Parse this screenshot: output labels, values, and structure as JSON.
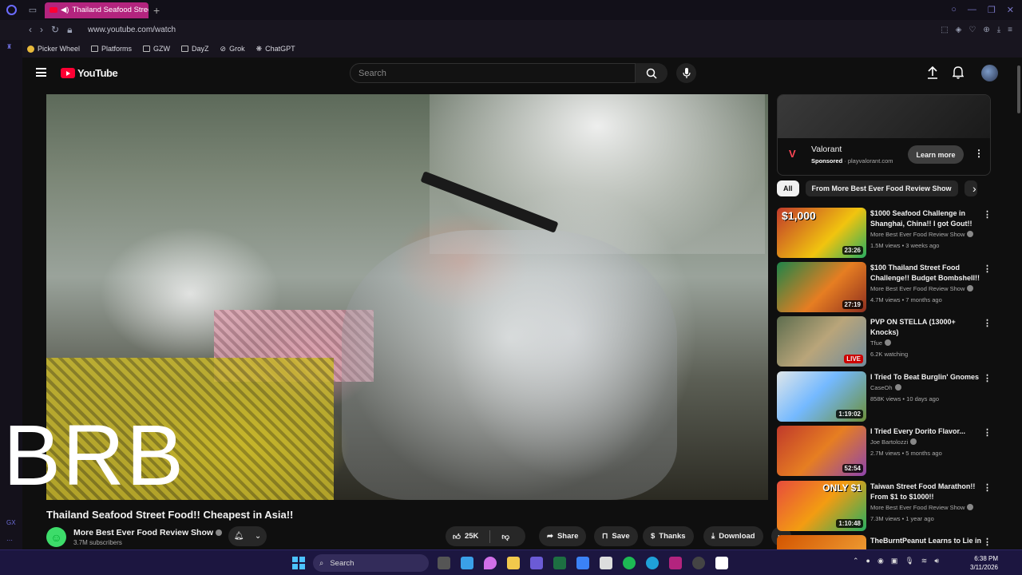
{
  "browser": {
    "tab_title": "Thailand Seafood Street",
    "url": "www.youtube.com/watch",
    "bookmarks": [
      "Picker Wheel",
      "Platforms",
      "GZW",
      "DayZ",
      "Grok",
      "ChatGPT"
    ],
    "side_rail_label": "GX"
  },
  "youtube": {
    "logo_text": "YouTube",
    "search_placeholder": "Search"
  },
  "video": {
    "overlay_text": "BRB",
    "title": "Thailand Seafood Street Food!! Cheapest in Asia!!",
    "channel": "More Best Ever Food Review Show",
    "subscribers": "3.7M subscribers",
    "likes": "25K",
    "share_label": "Share",
    "save_label": "Save",
    "thanks_label": "Thanks",
    "download_label": "Download"
  },
  "ad": {
    "title": "Valorant",
    "sponsored": "Sponsored",
    "domain": "playvalorant.com",
    "cta": "Learn more"
  },
  "chips": [
    "All",
    "From More Best Ever Food Review Show"
  ],
  "recommendations": [
    {
      "title": "$1000 Seafood Challenge in Shanghai, China!! I got Gout!!",
      "channel": "More Best Ever Food Review Show",
      "meta": "1.5M views • 3 weeks ago",
      "duration": "23:26",
      "thumb_text": "$1,000"
    },
    {
      "title": "$100 Thailand Street Food Challenge!! Budget Bombshell!!",
      "channel": "More Best Ever Food Review Show",
      "meta": "4.7M views • 7 months ago",
      "duration": "27:19",
      "thumb_text": ""
    },
    {
      "title": "PVP ON STELLA (13000+ Knocks)",
      "channel": "Tfue",
      "meta": "6.2K watching",
      "duration": "LIVE",
      "thumb_text": ""
    },
    {
      "title": "I Tried To Beat Burglin' Gnomes",
      "channel": "CaseOh",
      "meta": "858K views • 10 days ago",
      "duration": "1:19:02",
      "thumb_text": ""
    },
    {
      "title": "I Tried Every Dorito Flavor...",
      "channel": "Joe Bartolozzi",
      "meta": "2.7M views • 5 months ago",
      "duration": "52:54",
      "thumb_text": ""
    },
    {
      "title": "Taiwan Street Food Marathon!! From $1 to $1000!!",
      "channel": "More Best Ever Food Review Show",
      "meta": "7.3M views • 1 year ago",
      "duration": "1:10:48",
      "thumb_text": "ONLY $1"
    },
    {
      "title": "TheBurntPeanut Learns to Lie in",
      "channel": "",
      "meta": "",
      "duration": "",
      "thumb_text": ""
    }
  ],
  "taskbar": {
    "search_label": "Search",
    "time": "6:38 PM",
    "date": "3/11/2026"
  }
}
